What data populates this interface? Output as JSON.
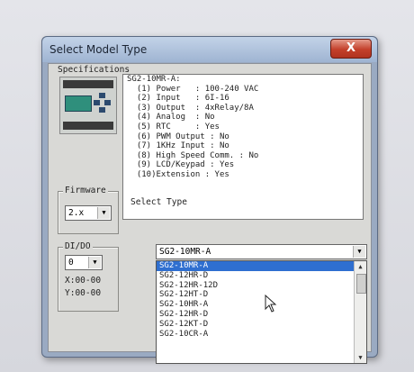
{
  "dialog": {
    "title": "Select Model Type",
    "close_label": "X"
  },
  "specifications": {
    "legend": "Specifications",
    "lines": [
      "SG2-10MR-A:",
      "  (1) Power   : 100-240 VAC",
      "  (2) Input   : 6I-16",
      "  (3) Output  : 4xRelay/8A",
      "  (4) Analog  : No",
      "  (5) RTC     : Yes",
      "  (6) PWM Output : No",
      "  (7) 1KHz Input : No",
      "  (8) High Speed Comm. : No",
      "  (9) LCD/Keypad : Yes",
      "  (10)Extension : Yes"
    ]
  },
  "firmware": {
    "legend": "Firmware",
    "value": "2.x"
  },
  "io": {
    "legend": "DI/DO",
    "value": "0",
    "x_label": "X:00-00",
    "y_label": "Y:00-00"
  },
  "select_type": {
    "label": "Select  Type",
    "value": "SG2-10MR-A",
    "options": [
      "SG2-10MR-A",
      "SG2-12HR-D",
      "SG2-12HR-12D",
      "SG2-12HT-D",
      "SG2-10HR-A",
      "SG2-12HR-D",
      "SG2-12KT-D",
      "SG2-10CR-A"
    ],
    "selected_index": 0
  }
}
